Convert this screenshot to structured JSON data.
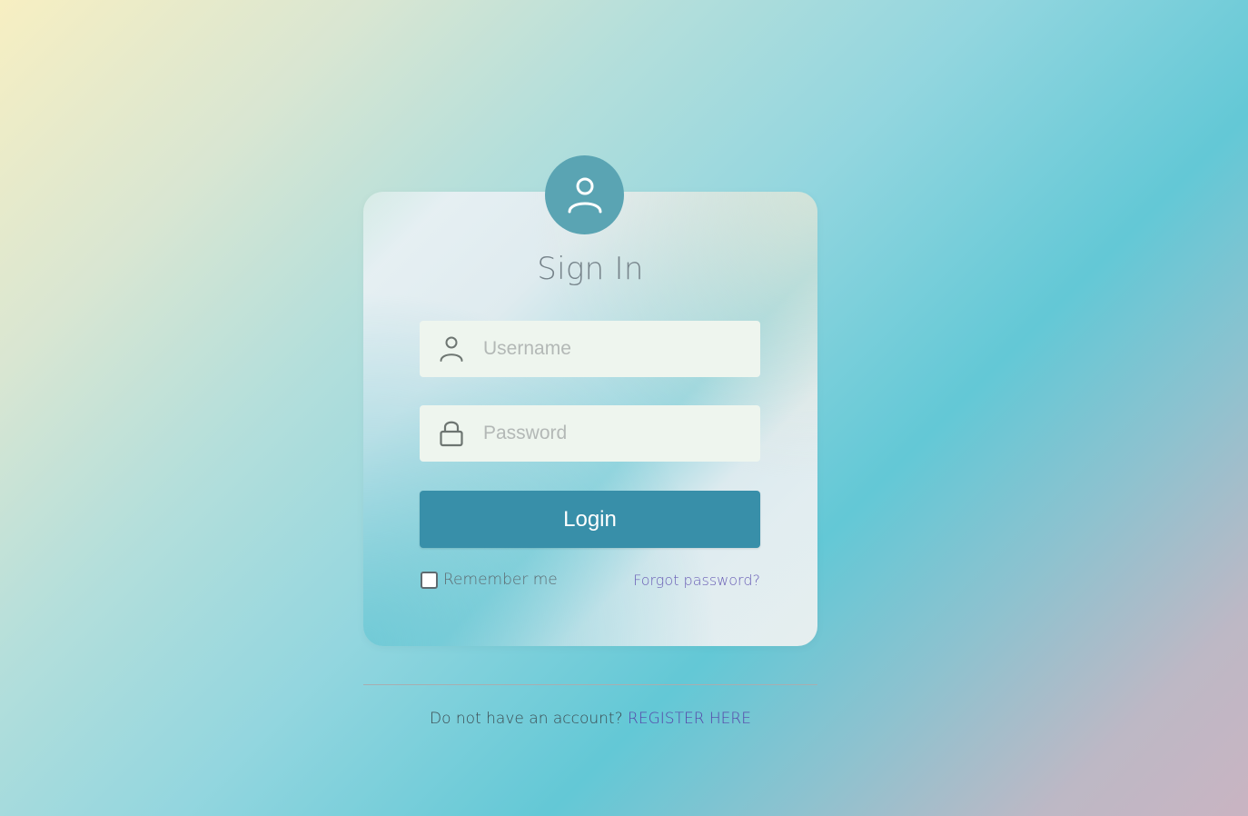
{
  "form": {
    "title": "Sign In",
    "username_placeholder": "Username",
    "password_placeholder": "Password",
    "login_label": "Login",
    "remember_label": "Remember me",
    "remember_checked": false,
    "forgot_label": "Forgot password?"
  },
  "footer": {
    "prompt": "Do not have an account?",
    "register_label": "REGISTER HERE"
  },
  "icons": {
    "avatar": "user-icon",
    "username": "user-icon",
    "password": "lock-icon"
  },
  "colors": {
    "accent": "#388fa9",
    "avatar_bg": "#5aa4b3",
    "link": "#5645a8",
    "field_bg": "#eef5ee"
  }
}
